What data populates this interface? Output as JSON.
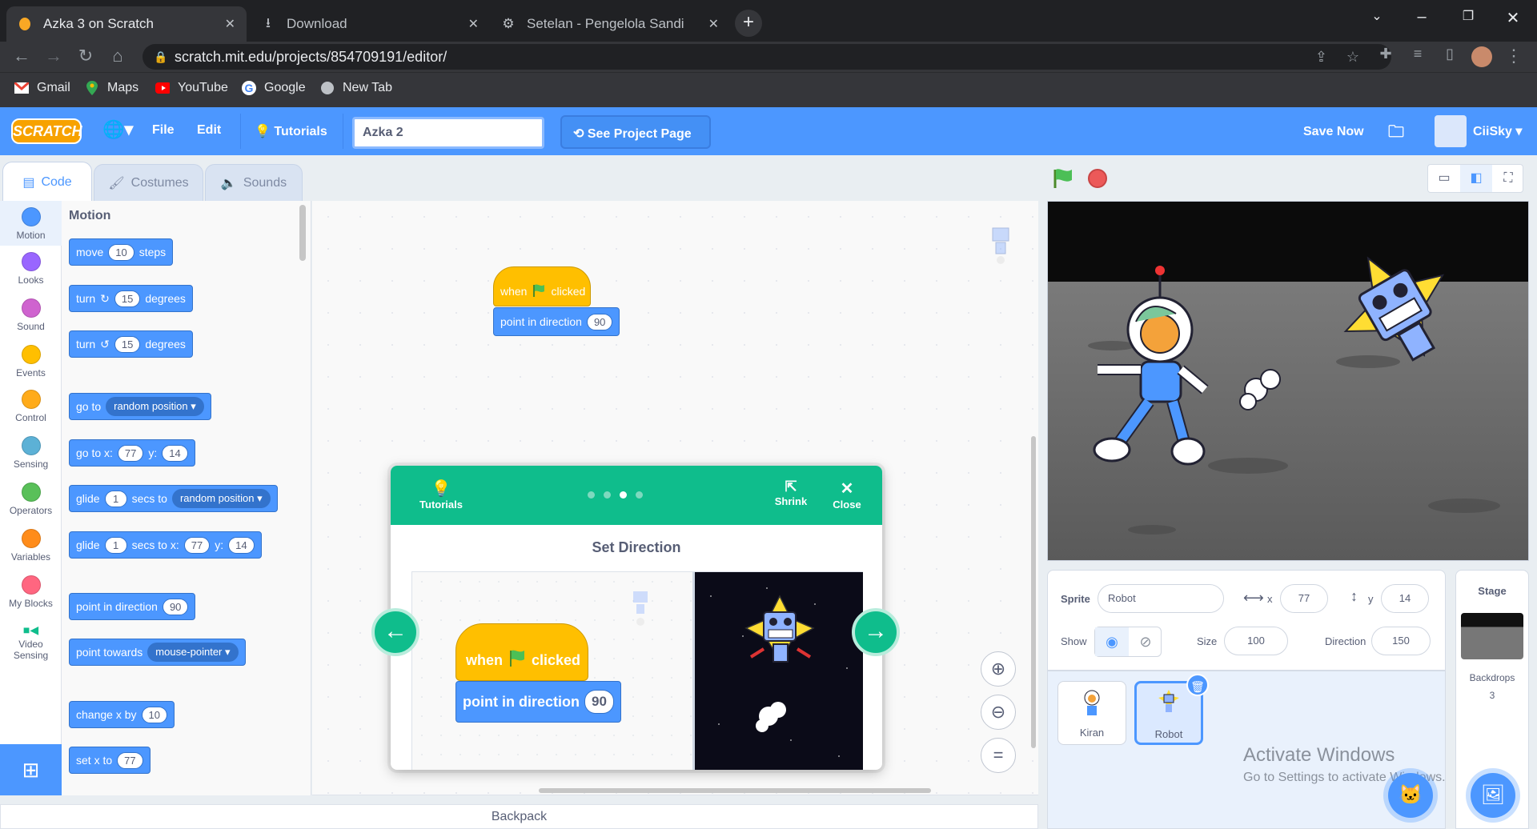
{
  "browser": {
    "tabs": [
      {
        "title": "Azka 3 on Scratch"
      },
      {
        "title": "Download"
      },
      {
        "title": "Setelan - Pengelola Sandi"
      }
    ],
    "url": "scratch.mit.edu/projects/854709191/editor/",
    "bookmarks": [
      "Gmail",
      "Maps",
      "YouTube",
      "Google",
      "New Tab"
    ]
  },
  "menubar": {
    "file": "File",
    "edit": "Edit",
    "tutorials": "Tutorials",
    "project_name": "Azka 2",
    "see_project": "See Project Page",
    "save_now": "Save Now",
    "username": "CiiSky"
  },
  "editor_tabs": [
    "Code",
    "Costumes",
    "Sounds"
  ],
  "categories": [
    {
      "label": "Motion",
      "color": "#4c97ff"
    },
    {
      "label": "Looks",
      "color": "#9966ff"
    },
    {
      "label": "Sound",
      "color": "#cf63cf"
    },
    {
      "label": "Events",
      "color": "#ffbf00"
    },
    {
      "label": "Control",
      "color": "#ffab19"
    },
    {
      "label": "Sensing",
      "color": "#5cb1d6"
    },
    {
      "label": "Operators",
      "color": "#59c059"
    },
    {
      "label": "Variables",
      "color": "#ff8c1a"
    },
    {
      "label": "My Blocks",
      "color": "#ff6680"
    },
    {
      "label": "Video Sensing",
      "color": "#0fbd8c"
    }
  ],
  "palette": {
    "title": "Motion",
    "move": {
      "a": "move",
      "v": "10",
      "b": "steps"
    },
    "turn_cw": {
      "a": "turn",
      "v": "15",
      "b": "degrees"
    },
    "turn_ccw": {
      "a": "turn",
      "v": "15",
      "b": "degrees"
    },
    "goto": {
      "a": "go to",
      "dd": "random position"
    },
    "gotoxy": {
      "a": "go to x:",
      "x": "77",
      "b": "y:",
      "y": "14"
    },
    "glide": {
      "a": "glide",
      "v": "1",
      "b": "secs to",
      "dd": "random position"
    },
    "glidexy": {
      "a": "glide",
      "v": "1",
      "b": "secs to x:",
      "x": "77",
      "c": "y:",
      "y": "14"
    },
    "pointdir": {
      "a": "point in direction",
      "v": "90"
    },
    "pointtowards": {
      "a": "point towards",
      "dd": "mouse-pointer"
    },
    "changex": {
      "a": "change x by",
      "v": "10"
    },
    "setx": {
      "a": "set x to",
      "v": "77"
    }
  },
  "script": {
    "hat_when": "when",
    "hat_clicked": "clicked",
    "point": "point in direction",
    "point_value": "90"
  },
  "tutorial": {
    "tutorials_label": "Tutorials",
    "shrink": "Shrink",
    "close": "Close",
    "title": "Set Direction",
    "when": "when",
    "clicked": "clicked",
    "point": "point in direction",
    "point_value": "90",
    "step": 3,
    "steps": 4
  },
  "sprite_info": {
    "sprite_label": "Sprite",
    "sprite_name": "Robot",
    "x_label": "x",
    "x": "77",
    "y_label": "y",
    "y": "14",
    "show_label": "Show",
    "size_label": "Size",
    "size": "100",
    "direction_label": "Direction",
    "direction": "150"
  },
  "sprites": [
    {
      "name": "Kiran"
    },
    {
      "name": "Robot"
    }
  ],
  "stage_panel": {
    "title": "Stage",
    "backdrops_label": "Backdrops",
    "backdrops_count": "3"
  },
  "backpack": "Backpack",
  "watermark": {
    "line1": "Activate Windows",
    "line2": "Go to Settings to activate Windows."
  }
}
